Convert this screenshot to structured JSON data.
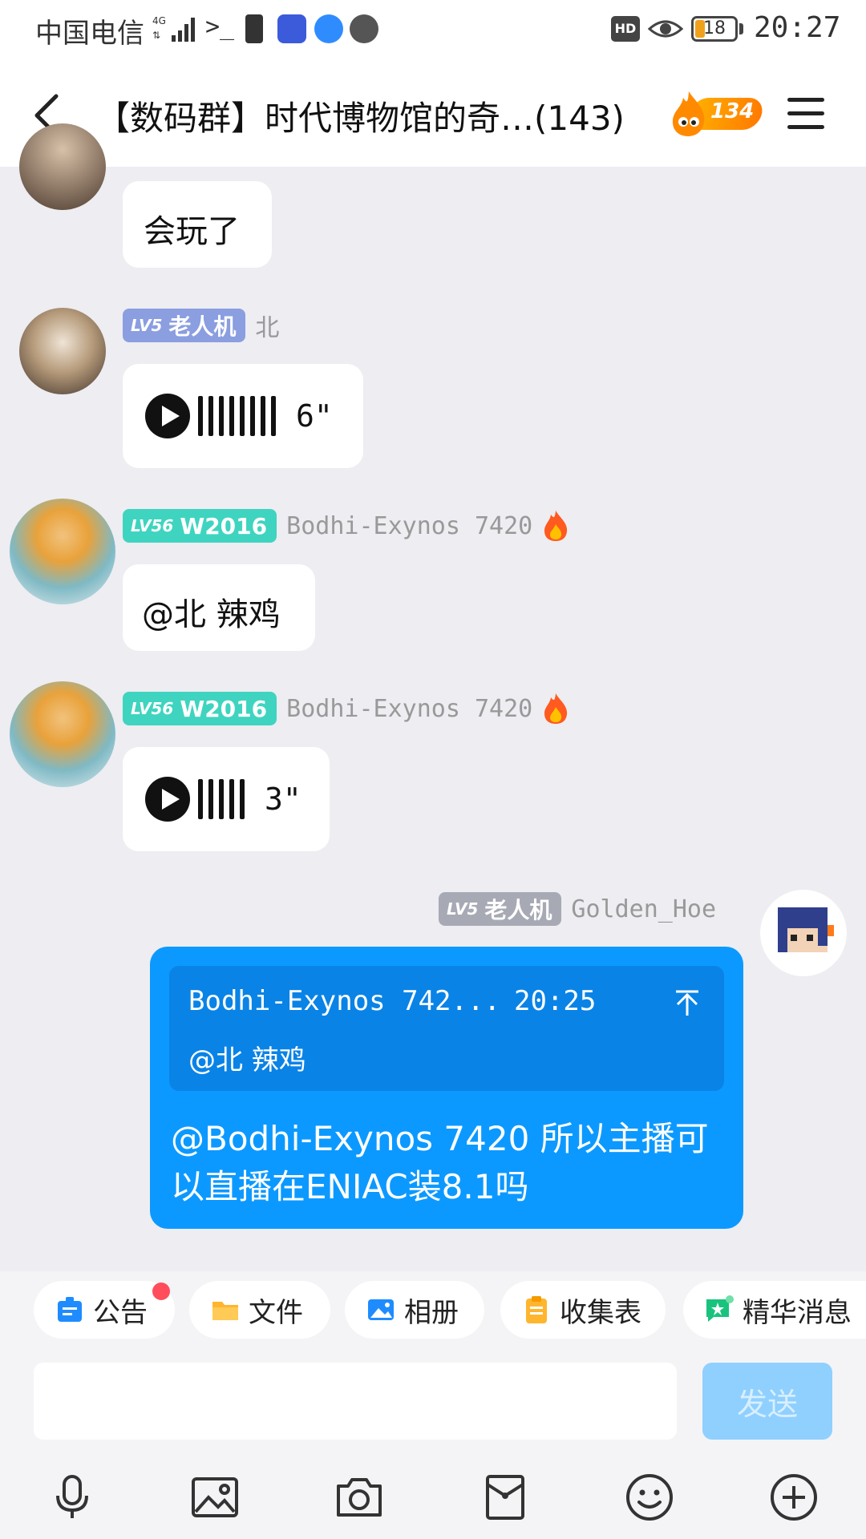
{
  "status_bar": {
    "carrier": "中国电信",
    "terminal": ">_",
    "hd": "HD",
    "battery": "18",
    "time": "20:27"
  },
  "header": {
    "title": "【数码群】时代博物馆的奇…(143)",
    "fire_count": "134"
  },
  "messages": [
    {
      "text": "会玩了"
    },
    {
      "level": "LV5",
      "title": "老人机",
      "nick": "北",
      "voice_duration": "6\""
    },
    {
      "level": "LV56",
      "title": "W2016",
      "nick": "Bodhi-Exynos 7420",
      "text": "@北 辣鸡"
    },
    {
      "level": "LV56",
      "title": "W2016",
      "nick": "Bodhi-Exynos 7420",
      "voice_duration": "3\""
    }
  ],
  "my_message": {
    "level": "LV5",
    "title": "老人机",
    "nick": "Golden_Hoe",
    "quote_name": "Bodhi-Exynos 742...",
    "quote_time": "20:25",
    "quote_text": "@北 辣鸡",
    "text": "@Bodhi-Exynos 7420 所以主播可以直播在ENIAC装8.1吗"
  },
  "shortcuts": [
    "公告",
    "文件",
    "相册",
    "收集表",
    "精华消息"
  ],
  "input": {
    "value": "",
    "send_label": "发送"
  },
  "colors": {
    "accent": "#0c99ff",
    "send_disabled": "#8fd0ff",
    "level_green": "#3fd4c0",
    "level_blue": "#8a9ee0"
  },
  "icons": [
    "back-icon",
    "menu-icon",
    "play-icon",
    "mic-icon",
    "image-icon",
    "camera-icon",
    "redpacket-icon",
    "emoji-icon",
    "plus-icon"
  ]
}
